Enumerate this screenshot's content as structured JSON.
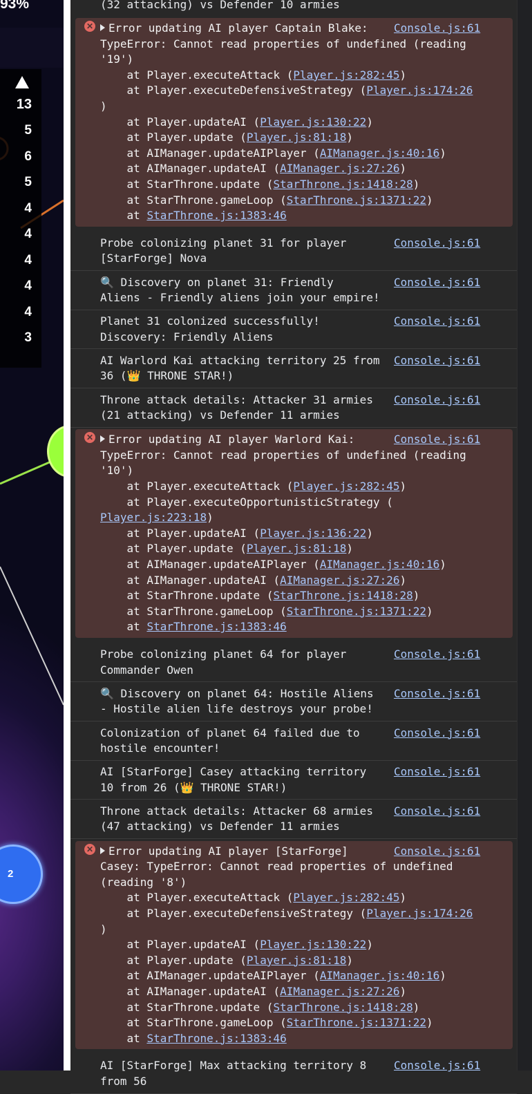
{
  "game": {
    "percent": "93%",
    "leaderboard": [
      "13",
      "5",
      "6",
      "5",
      "4",
      "4",
      "4",
      "4",
      "4",
      "3"
    ],
    "node_blue_label": "2"
  },
  "console": {
    "top_line": "(32 attacking) vs Defender 10 armies",
    "source": "Console.js:61",
    "error1": {
      "head": "Error updating AI player Captain Blake:",
      "lines": [
        "TypeError: Cannot read properties of undefined (reading",
        "'19')"
      ],
      "stack": [
        {
          "pre": "    at Player.executeAttack (",
          "link": "Player.js:282:45",
          "post": ")"
        },
        {
          "pre": "    at Player.executeDefensiveStrategy (",
          "link": "Player.js:174:26",
          "post": ""
        },
        {
          "pre": ")",
          "link": "",
          "post": ""
        },
        {
          "pre": "    at Player.updateAI (",
          "link": "Player.js:130:22",
          "post": ")"
        },
        {
          "pre": "    at Player.update (",
          "link": "Player.js:81:18",
          "post": ")"
        },
        {
          "pre": "    at AIManager.updateAIPlayer (",
          "link": "AIManager.js:40:16",
          "post": ")"
        },
        {
          "pre": "    at AIManager.updateAI (",
          "link": "AIManager.js:27:26",
          "post": ")"
        },
        {
          "pre": "    at StarThrone.update (",
          "link": "StarThrone.js:1418:28",
          "post": ")"
        },
        {
          "pre": "    at StarThrone.gameLoop (",
          "link": "StarThrone.js:1371:22",
          "post": ")"
        },
        {
          "pre": "    at ",
          "link": "StarThrone.js:1383:46",
          "post": ""
        }
      ]
    },
    "logs1": [
      [
        "Probe colonizing planet 31 for player",
        "[StarForge] Nova"
      ],
      [
        "🔍 Discovery on planet 31: Friendly",
        "Aliens - Friendly aliens join your empire!"
      ],
      [
        "Planet 31 colonized successfully!",
        "Discovery: Friendly Aliens"
      ],
      [
        "AI Warlord Kai attacking territory 25 from",
        "36 (👑 THRONE STAR!)"
      ],
      [
        "Throne attack details: Attacker 31 armies",
        "(21 attacking) vs Defender 11 armies"
      ]
    ],
    "error2": {
      "head": "Error updating AI player Warlord Kai:",
      "lines": [
        "TypeError: Cannot read properties of undefined (reading",
        "'10')"
      ],
      "stack": [
        {
          "pre": "    at Player.executeAttack (",
          "link": "Player.js:282:45",
          "post": ")"
        },
        {
          "pre": "    at Player.executeOpportunisticStrategy (",
          "link": "",
          "post": ""
        },
        {
          "pre": "",
          "link": "Player.js:223:18",
          "post": ")"
        },
        {
          "pre": "    at Player.updateAI (",
          "link": "Player.js:136:22",
          "post": ")"
        },
        {
          "pre": "    at Player.update (",
          "link": "Player.js:81:18",
          "post": ")"
        },
        {
          "pre": "    at AIManager.updateAIPlayer (",
          "link": "AIManager.js:40:16",
          "post": ")"
        },
        {
          "pre": "    at AIManager.updateAI (",
          "link": "AIManager.js:27:26",
          "post": ")"
        },
        {
          "pre": "    at StarThrone.update (",
          "link": "StarThrone.js:1418:28",
          "post": ")"
        },
        {
          "pre": "    at StarThrone.gameLoop (",
          "link": "StarThrone.js:1371:22",
          "post": ")"
        },
        {
          "pre": "    at ",
          "link": "StarThrone.js:1383:46",
          "post": ""
        }
      ]
    },
    "logs2": [
      [
        "Probe colonizing planet 64 for player",
        "Commander Owen"
      ],
      [
        "🔍 Discovery on planet 64: Hostile Aliens",
        "- Hostile alien life destroys your probe!"
      ],
      [
        "Colonization of planet 64 failed due to",
        "hostile encounter!"
      ],
      [
        "AI [StarForge] Casey attacking territory",
        "10 from 26 (👑 THRONE STAR!)"
      ],
      [
        "Throne attack details: Attacker 68 armies",
        "(47 attacking) vs Defender 11 armies"
      ]
    ],
    "error3": {
      "head": "Error updating AI player [StarForge]",
      "lines": [
        "Casey: TypeError: Cannot read properties of undefined",
        "(reading '8')"
      ],
      "stack": [
        {
          "pre": "    at Player.executeAttack (",
          "link": "Player.js:282:45",
          "post": ")"
        },
        {
          "pre": "    at Player.executeDefensiveStrategy (",
          "link": "Player.js:174:26",
          "post": ""
        },
        {
          "pre": ")",
          "link": "",
          "post": ""
        },
        {
          "pre": "    at Player.updateAI (",
          "link": "Player.js:130:22",
          "post": ")"
        },
        {
          "pre": "    at Player.update (",
          "link": "Player.js:81:18",
          "post": ")"
        },
        {
          "pre": "    at AIManager.updateAIPlayer (",
          "link": "AIManager.js:40:16",
          "post": ")"
        },
        {
          "pre": "    at AIManager.updateAI (",
          "link": "AIManager.js:27:26",
          "post": ")"
        },
        {
          "pre": "    at StarThrone.update (",
          "link": "StarThrone.js:1418:28",
          "post": ")"
        },
        {
          "pre": "    at StarThrone.gameLoop (",
          "link": "StarThrone.js:1371:22",
          "post": ")"
        },
        {
          "pre": "    at ",
          "link": "StarThrone.js:1383:46",
          "post": ""
        }
      ]
    },
    "last_log": [
      "AI [StarForge] Max attacking territory 8",
      "from 56"
    ]
  }
}
